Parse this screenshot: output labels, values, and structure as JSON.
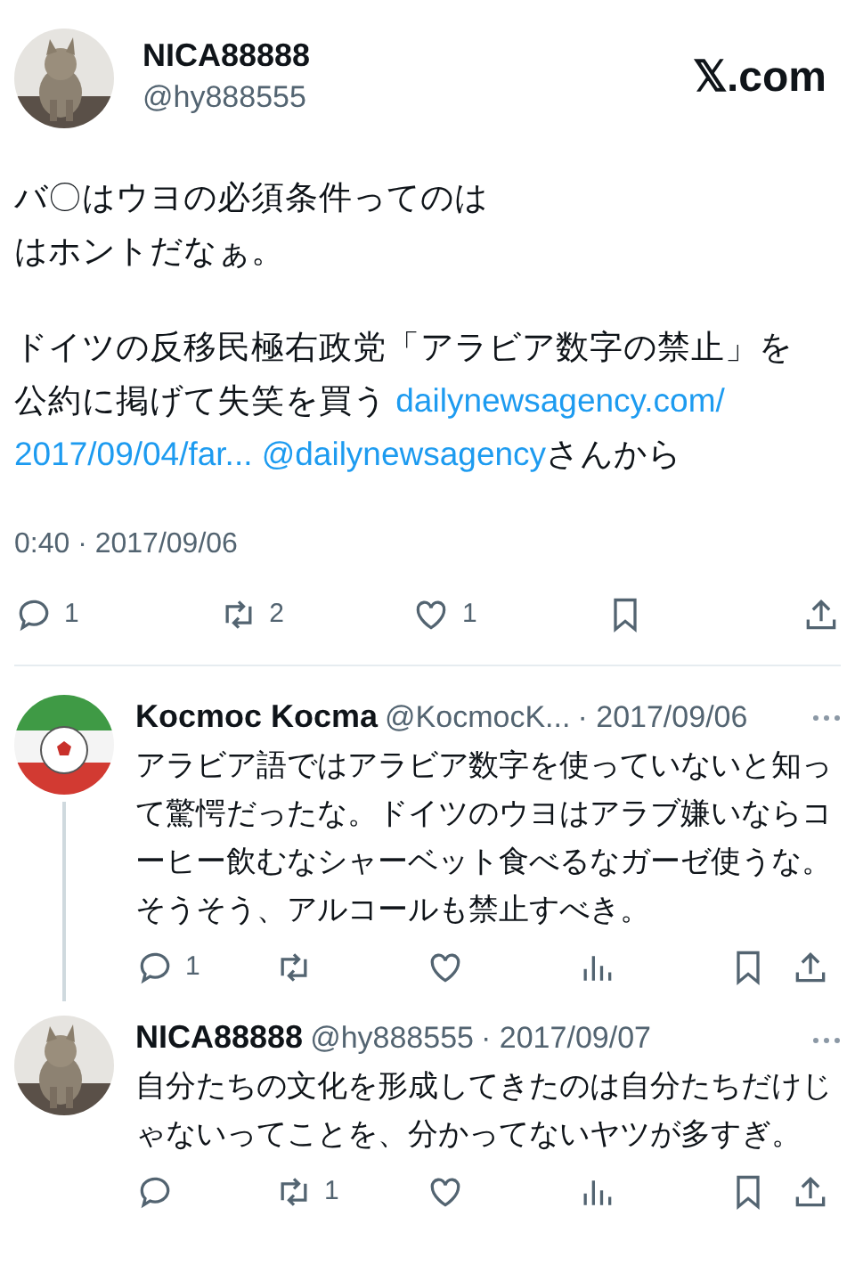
{
  "post": {
    "author": {
      "name": "NICA88888",
      "handle": "@hy888555"
    },
    "site": "𝕏.com",
    "paragraphs": [
      [
        [
          {
            "kind": "text",
            "text": "バ〇はウヨの必須条件ってのは"
          }
        ],
        [
          {
            "kind": "text",
            "text": "はホントだなぁ。"
          }
        ]
      ],
      [
        [
          {
            "kind": "text",
            "text": "ドイツの反移民極右政党「アラビア数字の禁止」を"
          }
        ],
        [
          {
            "kind": "text",
            "text": "公約に掲げて失笑を買う "
          },
          {
            "kind": "link",
            "text": "dailynewsagency.com/"
          }
        ],
        [
          {
            "kind": "link",
            "text": "2017/09/04/far..."
          },
          {
            "kind": "link",
            "text": "@dailynewsagency"
          },
          {
            "kind": "text",
            "text": "さんから"
          }
        ]
      ]
    ],
    "timestamp": "0:40 · 2017/09/06",
    "actions": [
      {
        "kind": "reply",
        "count": "1"
      },
      {
        "kind": "repost",
        "count": "2"
      },
      {
        "kind": "like",
        "count": "1"
      },
      {
        "kind": "bookmark"
      },
      {
        "kind": "share"
      }
    ]
  },
  "replies": [
    {
      "name": "Kocmoc Kocma",
      "handle": "@KocmocK...",
      "date": "· 2017/09/06",
      "text": "アラビア語ではアラビア数字を使っていないと知って驚愕だったな。ドイツのウヨはアラブ嫌いならコーヒー飲むなシャーベット食べるなガーゼ使うな。そうそう、アルコールも禁止すべき。",
      "thread_line": true,
      "actions": [
        {
          "kind": "reply",
          "count": "1"
        },
        {
          "kind": "repost"
        },
        {
          "kind": "like"
        },
        {
          "kind": "views"
        },
        {
          "kind": "bookmark"
        },
        {
          "kind": "share"
        }
      ]
    },
    {
      "name": "NICA88888",
      "handle": "@hy888555",
      "date": "· 2017/09/07",
      "text": "自分たちの文化を形成してきたのは自分たちだけじゃないってことを、分かってないヤツが多すぎ。",
      "thread_line": false,
      "actions": [
        {
          "kind": "reply"
        },
        {
          "kind": "repost",
          "count": "1"
        },
        {
          "kind": "like"
        },
        {
          "kind": "views"
        },
        {
          "kind": "bookmark"
        },
        {
          "kind": "share"
        }
      ]
    }
  ]
}
